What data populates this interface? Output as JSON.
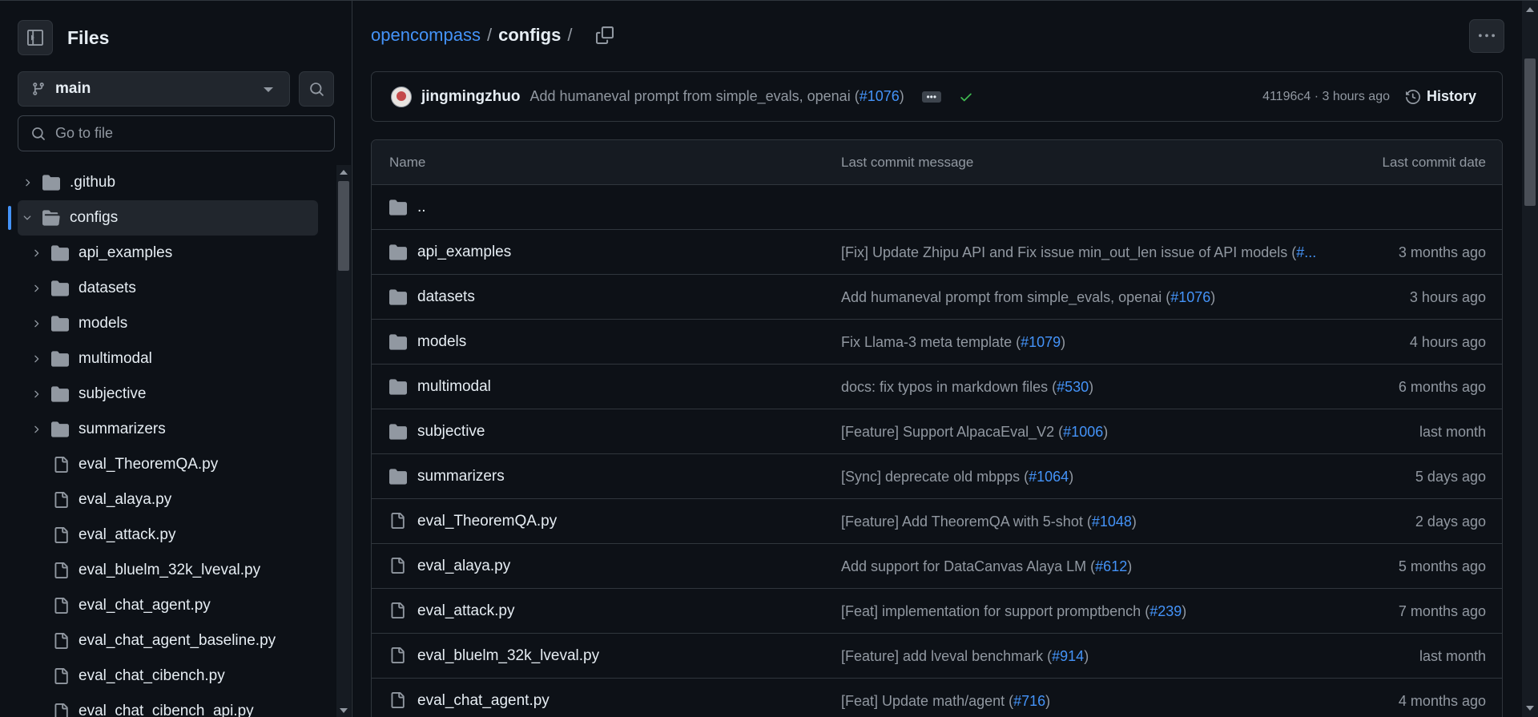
{
  "colors": {
    "background": "#0d1117",
    "link": "#4493f8",
    "muted_text": "#9198a1",
    "success": "#3fb950",
    "border": "#30363d"
  },
  "sidebar": {
    "title": "Files",
    "branch": "main",
    "goto_placeholder": "Go to file",
    "tree": [
      {
        "label": ".github",
        "type": "folder",
        "expanded": false,
        "level": 0
      },
      {
        "label": "configs",
        "type": "folder-open",
        "expanded": true,
        "level": 0,
        "selected": true
      },
      {
        "label": "api_examples",
        "type": "folder",
        "expanded": false,
        "level": 1
      },
      {
        "label": "datasets",
        "type": "folder",
        "expanded": false,
        "level": 1
      },
      {
        "label": "models",
        "type": "folder",
        "expanded": false,
        "level": 1
      },
      {
        "label": "multimodal",
        "type": "folder",
        "expanded": false,
        "level": 1
      },
      {
        "label": "subjective",
        "type": "folder",
        "expanded": false,
        "level": 1
      },
      {
        "label": "summarizers",
        "type": "folder",
        "expanded": false,
        "level": 1
      },
      {
        "label": "eval_TheoremQA.py",
        "type": "file",
        "level": 1
      },
      {
        "label": "eval_alaya.py",
        "type": "file",
        "level": 1
      },
      {
        "label": "eval_attack.py",
        "type": "file",
        "level": 1
      },
      {
        "label": "eval_bluelm_32k_lveval.py",
        "type": "file",
        "level": 1
      },
      {
        "label": "eval_chat_agent.py",
        "type": "file",
        "level": 1
      },
      {
        "label": "eval_chat_agent_baseline.py",
        "type": "file",
        "level": 1
      },
      {
        "label": "eval_chat_cibench.py",
        "type": "file",
        "level": 1
      },
      {
        "label": "eval_chat_cibench_api.py",
        "type": "file",
        "level": 1
      }
    ]
  },
  "breadcrumb": {
    "repo": "opencompass",
    "sep1": "/",
    "current": "configs",
    "sep2": "/"
  },
  "commit": {
    "author": "jingmingzhuo",
    "message": "Add humaneval prompt from simple_evals, openai (",
    "pr": "#1076",
    "message_end": ")",
    "ellipsis": "•••",
    "sha_time": "41196c4 · 3 hours ago",
    "history_label": "History"
  },
  "table": {
    "headers": {
      "name": "Name",
      "message": "Last commit message",
      "date": "Last commit date"
    },
    "parent": "..",
    "rows": [
      {
        "name": "api_examples",
        "type": "folder",
        "msg": "[Fix] Update Zhipu API and Fix issue min_out_len issue of API models (",
        "pr": "#...",
        "end": "",
        "date": "3 months ago"
      },
      {
        "name": "datasets",
        "type": "folder",
        "msg": "Add humaneval prompt from simple_evals, openai (",
        "pr": "#1076",
        "end": ")",
        "date": "3 hours ago"
      },
      {
        "name": "models",
        "type": "folder",
        "msg": "Fix Llama-3 meta template (",
        "pr": "#1079",
        "end": ")",
        "date": "4 hours ago"
      },
      {
        "name": "multimodal",
        "type": "folder",
        "msg": "docs: fix typos in markdown files (",
        "pr": "#530",
        "end": ")",
        "date": "6 months ago"
      },
      {
        "name": "subjective",
        "type": "folder",
        "msg": "[Feature] Support AlpacaEval_V2 (",
        "pr": "#1006",
        "end": ")",
        "date": "last month"
      },
      {
        "name": "summarizers",
        "type": "folder",
        "msg": "[Sync] deprecate old mbpps (",
        "pr": "#1064",
        "end": ")",
        "date": "5 days ago"
      },
      {
        "name": "eval_TheoremQA.py",
        "type": "file",
        "msg": "[Feature] Add TheoremQA with 5-shot (",
        "pr": "#1048",
        "end": ")",
        "date": "2 days ago"
      },
      {
        "name": "eval_alaya.py",
        "type": "file",
        "msg": "Add support for DataCanvas Alaya LM (",
        "pr": "#612",
        "end": ")",
        "date": "5 months ago"
      },
      {
        "name": "eval_attack.py",
        "type": "file",
        "msg": "[Feat] implementation for support promptbench (",
        "pr": "#239",
        "end": ")",
        "date": "7 months ago"
      },
      {
        "name": "eval_bluelm_32k_lveval.py",
        "type": "file",
        "msg": "[Feature] add lveval benchmark (",
        "pr": "#914",
        "end": ")",
        "date": "last month"
      },
      {
        "name": "eval_chat_agent.py",
        "type": "file",
        "msg": "[Feat] Update math/agent (",
        "pr": "#716",
        "end": ")",
        "date": "4 months ago"
      }
    ]
  }
}
